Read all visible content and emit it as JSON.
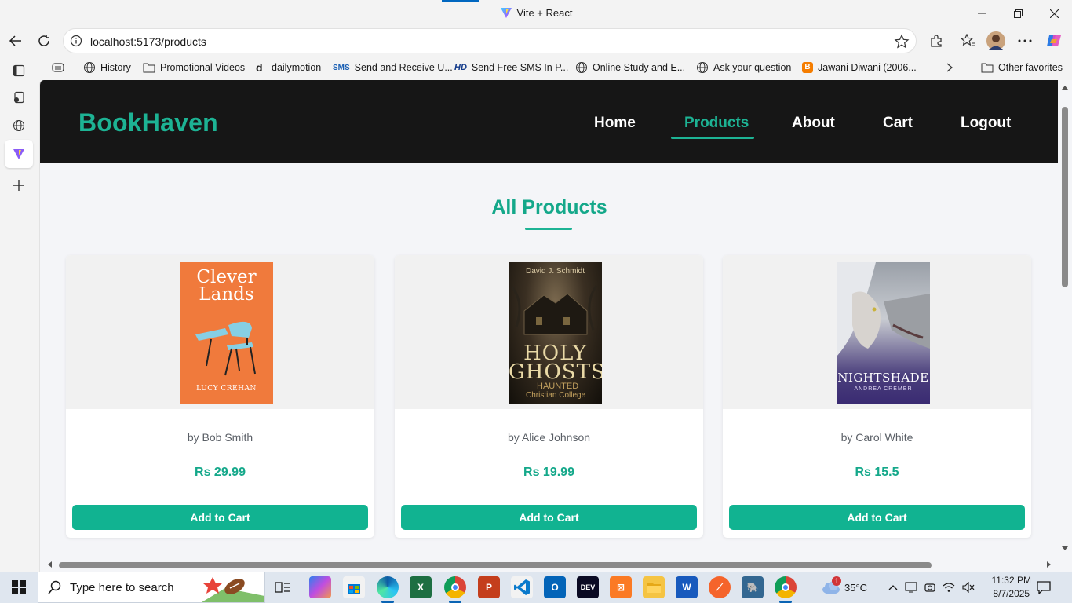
{
  "window": {
    "title": "Vite + React"
  },
  "browser": {
    "url": "localhost:5173/products",
    "favorites": [
      {
        "label": "History",
        "icon": "globe-icon"
      },
      {
        "label": "Promotional Videos",
        "icon": "folder-icon"
      },
      {
        "label": "dailymotion",
        "icon": "dailymotion-icon"
      },
      {
        "label": "Send and Receive U...",
        "icon": "sms-icon"
      },
      {
        "label": "Send Free SMS In P...",
        "icon": "hd-icon"
      },
      {
        "label": "Online Study and E...",
        "icon": "globe-icon"
      },
      {
        "label": "Ask your question",
        "icon": "globe-icon"
      },
      {
        "label": "Jawani Diwani (2006...",
        "icon": "blogger-icon"
      }
    ],
    "other_favorites": "Other favorites"
  },
  "site": {
    "brand": "BookHaven",
    "nav": [
      {
        "label": "Home",
        "active": false
      },
      {
        "label": "Products",
        "active": true
      },
      {
        "label": "About",
        "active": false
      },
      {
        "label": "Cart",
        "active": false
      },
      {
        "label": "Logout",
        "active": false
      }
    ],
    "page_title": "All Products",
    "accent_color": "#1db394",
    "products": [
      {
        "author": "by Bob Smith",
        "price": "Rs 29.99",
        "button": "Add to Cart",
        "cover": {
          "title_line1": "Clever",
          "title_line2": "Lands",
          "author": "LUCY CREHAN"
        }
      },
      {
        "author": "by Alice Johnson",
        "price": "Rs 19.99",
        "button": "Add to Cart",
        "cover": {
          "top_author": "David J. Schmidt",
          "title_line1": "HOLY",
          "title_line2": "GHOSTS",
          "subtitle": "HAUNTED",
          "sub2": "Christian College"
        }
      },
      {
        "author": "by Carol White",
        "price": "Rs 15.5",
        "button": "Add to Cart",
        "cover": {
          "title": "NIGHTSHADE",
          "author": "ANDREA CREMER"
        }
      }
    ]
  },
  "taskbar": {
    "search_placeholder": "Type here to search",
    "weather": "35°C",
    "weather_badge": "1",
    "time": "11:32 PM",
    "date": "8/7/2025"
  }
}
